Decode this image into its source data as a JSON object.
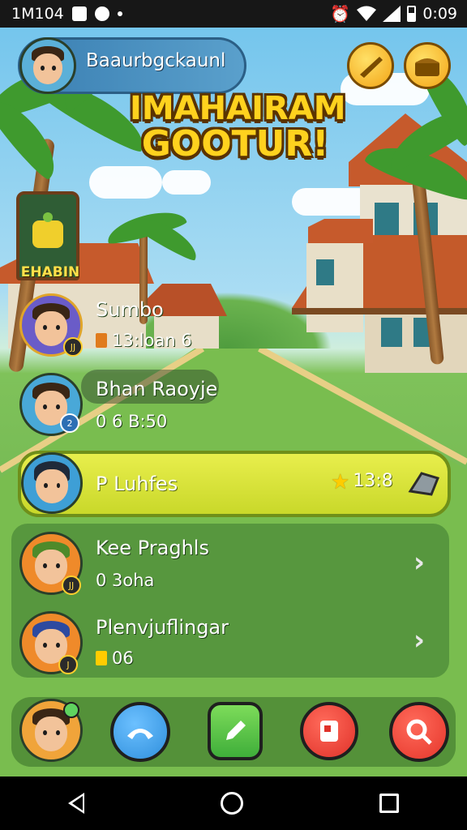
{
  "status_bar": {
    "left_text": "1M104",
    "time": "0:09",
    "icons": [
      "notification-icon",
      "app-icon",
      "dot-icon",
      "alarm-icon",
      "wifi-icon",
      "signal-icon",
      "battery-icon"
    ]
  },
  "profile": {
    "name": "Baaurbgckaunl"
  },
  "top_buttons": [
    "boomerang-icon",
    "chest-icon"
  ],
  "title": {
    "line1": "IMAHAIRAM",
    "line2": "GOOTUR!"
  },
  "sign": {
    "text": "EHABIN"
  },
  "players": [
    {
      "name": "Sumbo",
      "meta": "13:loan 6",
      "meta_icon": "level-icon",
      "badge": "JJ"
    },
    {
      "name": "Bhan Raoyje",
      "meta": "0 6 B:50",
      "badge": "2"
    },
    {
      "name": "P Luhfes",
      "rating": "13:8",
      "selected": true
    },
    {
      "name": "Kee Praghls",
      "meta": "0 3oha",
      "badge": "JJ"
    },
    {
      "name": "Plenvjuflingar",
      "meta": "06",
      "meta_icon": "level-icon",
      "badge": "J"
    }
  ],
  "action_bar": {
    "buttons": [
      "call-button",
      "edit-button",
      "rank-button",
      "search-button"
    ]
  },
  "colors": {
    "selected_bar": "#d9e23a",
    "title_fill": "#ffd21e",
    "call": "#2f8fdc",
    "edit": "#3fae3a",
    "rank": "#e0322a",
    "search": "#e5362b"
  }
}
